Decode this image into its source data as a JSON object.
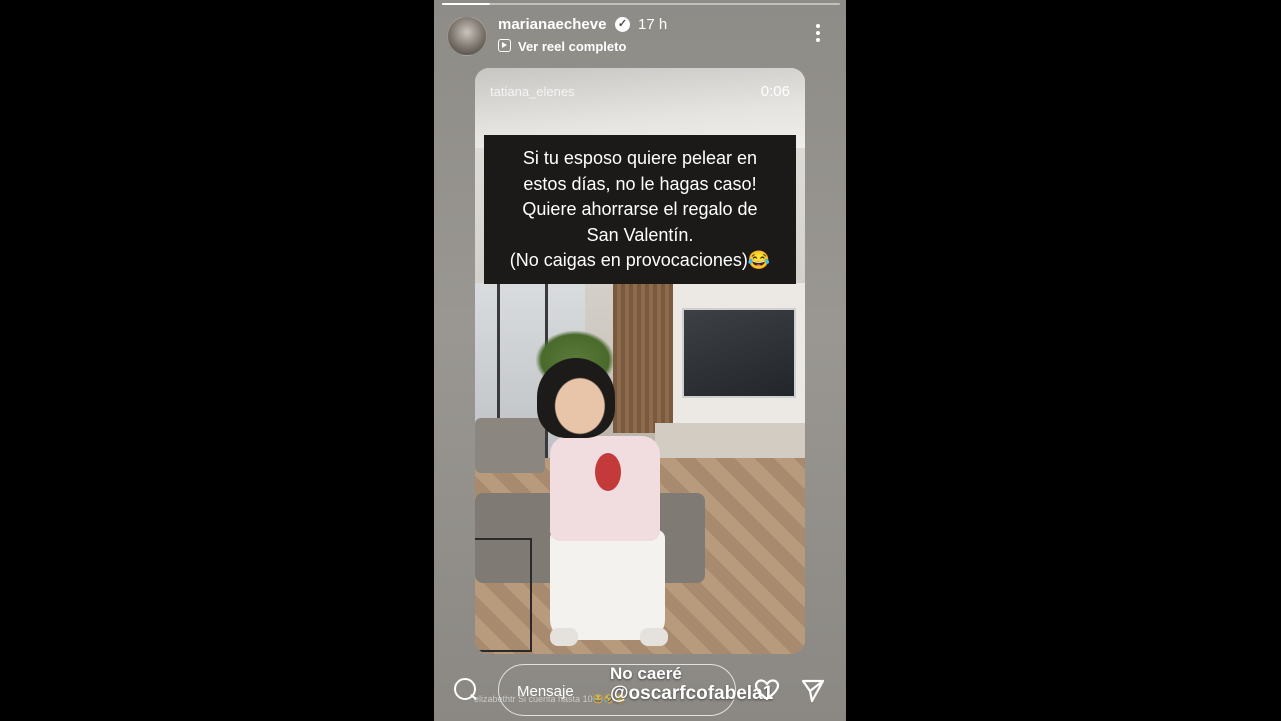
{
  "story": {
    "username": "marianaecheve",
    "time_ago": "17 h",
    "reel_link_label": "Ver reel completo",
    "progress_fraction": 0.12
  },
  "media": {
    "watermark": "tatiana_elenes",
    "duration": "0:06",
    "caption_lines": [
      "Si tu esposo quiere pelear en",
      "estos días, no le hagas caso!",
      "Quiere ahorrarse el regalo de",
      "San Valentín.",
      "(No caigas en provocaciones)😂"
    ]
  },
  "reply_bar": {
    "placeholder": "Mensaje",
    "sticker_line1": "No caeré",
    "sticker_line2": "@oscarfcofabela1",
    "overlay_comment": "elizabethtr Si cuenta hasta 10😂🤣😂"
  },
  "icons": {
    "verified": "verified-badge-icon",
    "reel": "reel-icon",
    "more": "more-options-icon",
    "camera": "camera-circle-icon",
    "like": "heart-icon",
    "send": "send-icon"
  }
}
